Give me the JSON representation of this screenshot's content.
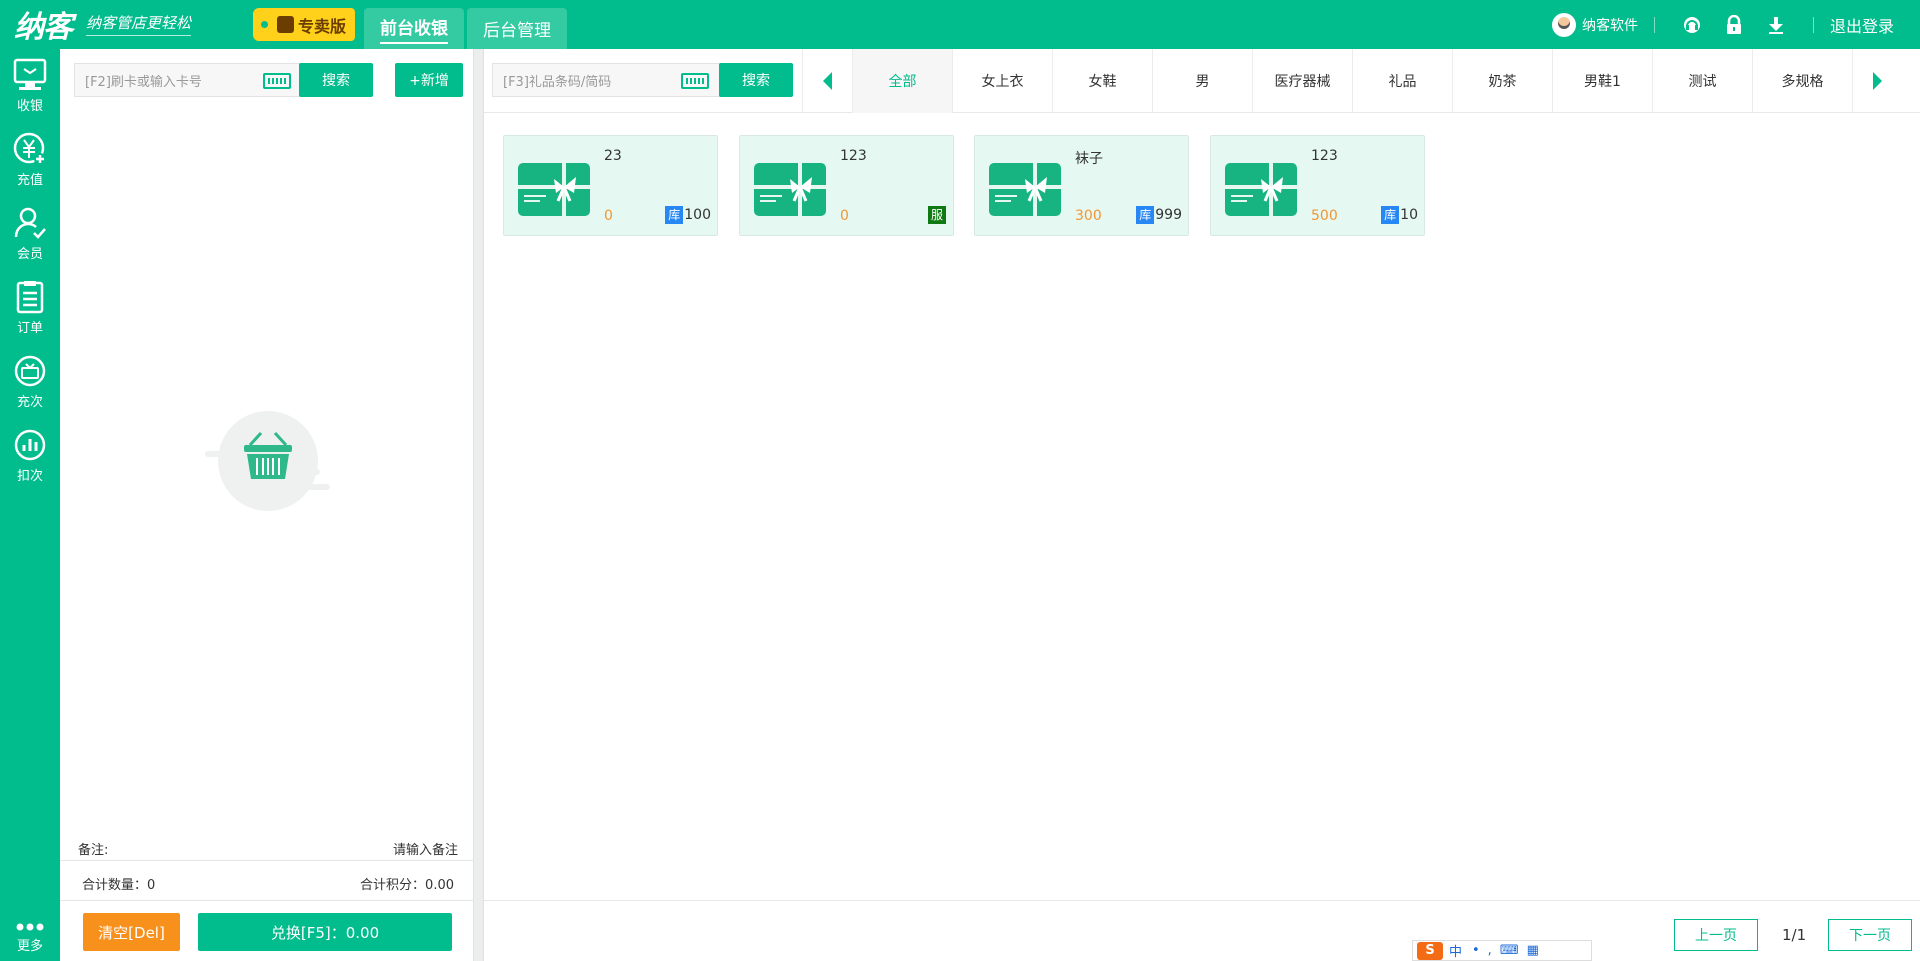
{
  "header": {
    "logo": "纳客",
    "slogan": "纳客管店更轻松",
    "edition": "专卖版",
    "tabs": [
      {
        "label": "前台收银",
        "active": true
      },
      {
        "label": "后台管理",
        "active": false
      }
    ],
    "user": "纳客软件",
    "logout": "退出登录"
  },
  "sidebar": {
    "items": [
      {
        "label": "收银",
        "icon": "cashier-icon"
      },
      {
        "label": "充值",
        "icon": "recharge-icon"
      },
      {
        "label": "会员",
        "icon": "member-icon"
      },
      {
        "label": "订单",
        "icon": "order-icon"
      },
      {
        "label": "充次",
        "icon": "recharge-times-icon"
      },
      {
        "label": "扣次",
        "icon": "deduct-times-icon"
      }
    ],
    "more": "更多"
  },
  "cart": {
    "search_placeholder": "[F2]刷卡或输入卡号",
    "search_button": "搜索",
    "add_button": "+新增",
    "remark_label": "备注:",
    "remark_placeholder": "请输入备注",
    "total_qty": "合计数量：0",
    "total_points": "合计积分：0.00",
    "clear_button": "清空[Del]",
    "pay_button": "兑换[F5]：0.00"
  },
  "products": {
    "search_placeholder": "[F3]礼品条码/简码",
    "search_button": "搜索",
    "categories": [
      "全部",
      "女上衣",
      "女鞋",
      "男",
      "医疗器械",
      "礼品",
      "奶茶",
      "男鞋1",
      "测试",
      "多规格"
    ],
    "active_category": "全部",
    "items": [
      {
        "name": "23",
        "price": "0",
        "badge": "库",
        "stock": "100"
      },
      {
        "name": "123",
        "price": "0",
        "badge": "服",
        "stock": ""
      },
      {
        "name": "袜子",
        "price": "300",
        "badge": "库",
        "stock": "999"
      },
      {
        "name": "123",
        "price": "500",
        "badge": "库",
        "stock": "10"
      }
    ],
    "pager": {
      "prev": "上一页",
      "info": "1/1",
      "next": "下一页"
    }
  },
  "ime": {
    "label": "中"
  },
  "colors": {
    "primary": "#01bc8c",
    "orange": "#f8911c",
    "edition": "#ffd11a",
    "stock_badge": "#2787f5",
    "service_badge": "#0f7a14"
  }
}
